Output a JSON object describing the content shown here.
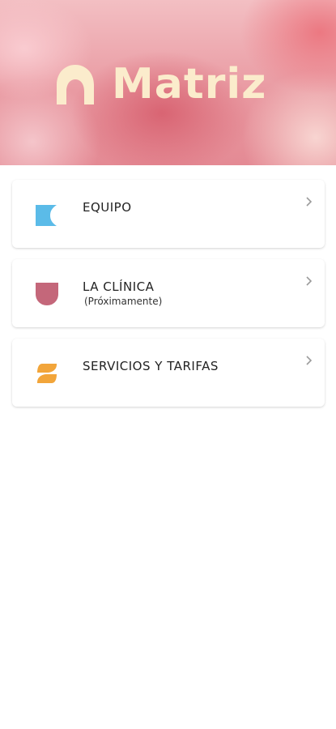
{
  "brand": {
    "name": "Matriz",
    "color": "#fbeccc"
  },
  "menu": {
    "items": [
      {
        "label": "EQUIPO",
        "sublabel": "",
        "icon": "equipo-icon",
        "color": "#5bbbe8"
      },
      {
        "label": "LA CLÍNICA",
        "sublabel": "(Próximamente)",
        "icon": "clinica-icon",
        "color": "#c4677a"
      },
      {
        "label": "SERVICIOS Y TARIFAS",
        "sublabel": "",
        "icon": "servicios-icon",
        "color": "#f2a53a"
      }
    ],
    "chevron_icon": "chevron-right-icon"
  }
}
